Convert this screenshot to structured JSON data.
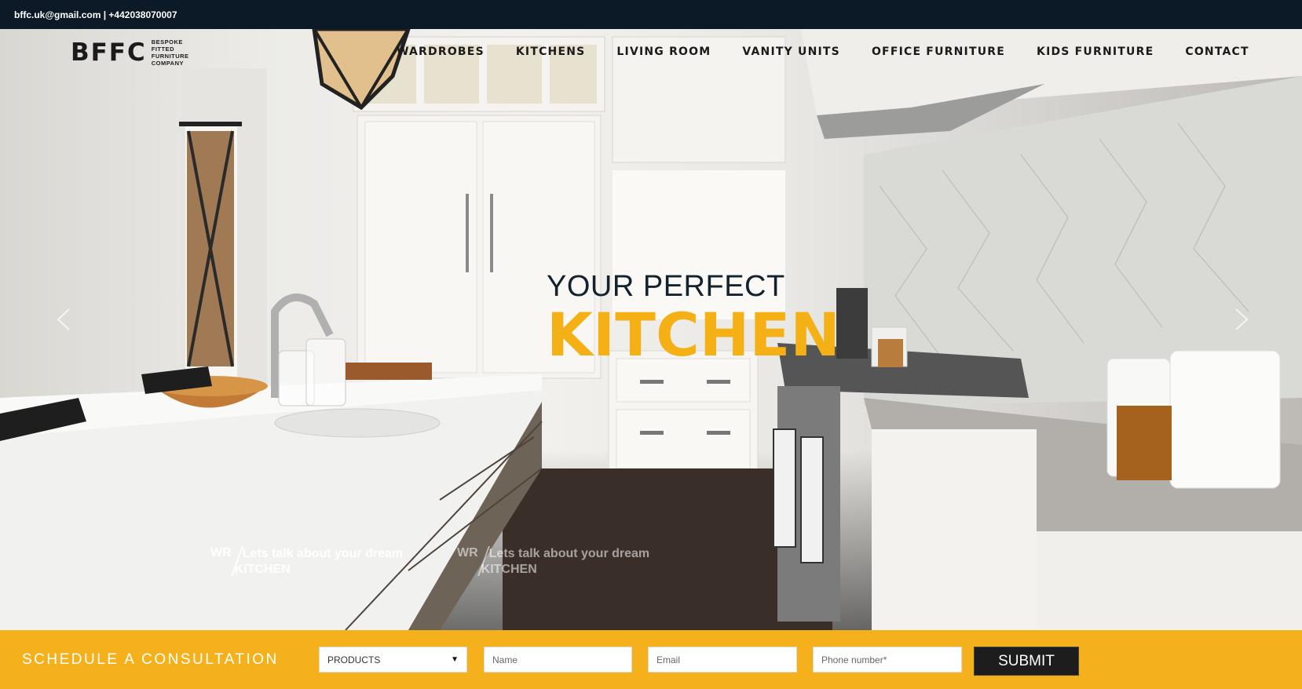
{
  "topbar": {
    "contact": "bffc.uk@gmail.com | +442038070007"
  },
  "logo": {
    "mark": "BFFC",
    "sub": [
      "BESPOKE",
      "FITTED",
      "FURNITURE",
      "COMPANY"
    ]
  },
  "nav": {
    "items": [
      "WARDROBES",
      "KITCHENS",
      "LIVING ROOM",
      "VANITY UNITS",
      "OFFICE FURNITURE",
      "KIDS FURNITURE",
      "CONTACT"
    ]
  },
  "hero": {
    "line1": "YOUR PERFECT",
    "line2": "KITCHEN",
    "prev_icon": "chevron-left-icon",
    "next_icon": "chevron-right-icon",
    "slides": [
      {
        "tag": "WR",
        "text": "Lets talk about your dream",
        "room": "KITCHEN"
      },
      {
        "tag": "WR",
        "text": "Lets talk about your dream",
        "room": "KITCHEN"
      }
    ]
  },
  "consultation": {
    "title": "SCHEDULE A CONSULTATION",
    "products_select": "PRODUCTS",
    "name_placeholder": "Name",
    "email_placeholder": "Email",
    "phone_placeholder": "Phone number*",
    "submit_label": "SUBMIT"
  },
  "colors": {
    "accent": "#f5b016",
    "dark": "#0b1a26",
    "bar": "#f5b11b"
  }
}
